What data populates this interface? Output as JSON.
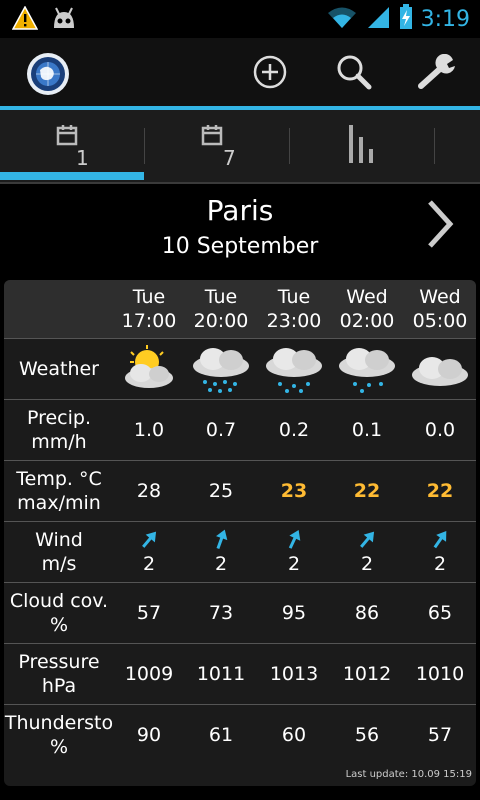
{
  "statusbar": {
    "time": "3:19",
    "icons": [
      "warning-icon",
      "android-robot-icon",
      "wifi-icon",
      "signal-icon",
      "battery-charging-icon"
    ],
    "accent": "#33b5e5"
  },
  "actionbar": {
    "logo": "weather-globe-logo",
    "buttons": [
      "add-icon",
      "search-icon",
      "settings-wrench-icon"
    ]
  },
  "tabs": [
    {
      "num": "1",
      "icon": "calendar-icon",
      "selected": true
    },
    {
      "num": "7",
      "icon": "calendar-icon",
      "selected": false
    },
    {
      "num": "",
      "icon": "bar-chart-icon",
      "selected": false
    }
  ],
  "location": {
    "city": "Paris",
    "date": "10 September"
  },
  "forecast": {
    "columns": [
      {
        "day": "Tue",
        "time": "17:00"
      },
      {
        "day": "Tue",
        "time": "20:00"
      },
      {
        "day": "Tue",
        "time": "23:00"
      },
      {
        "day": "Wed",
        "time": "02:00"
      },
      {
        "day": "Wed",
        "time": "05:00"
      }
    ],
    "rows": {
      "weather": {
        "label": "Weather",
        "icons": [
          "partly-sunny-cloud-icon",
          "rain-cloud-icon",
          "rain-cloud-icon",
          "rain-cloud-icon",
          "cloud-icon"
        ]
      },
      "precip": {
        "label_line1": "Precip.",
        "label_line2": "mm/h",
        "values": [
          "1.0",
          "0.7",
          "0.2",
          "0.1",
          "0.0"
        ]
      },
      "temp": {
        "label_line1": "Temp. °C",
        "label_line2": "max/min",
        "values": [
          "28",
          "25",
          "23",
          "22",
          "22"
        ],
        "warm_flags": [
          false,
          false,
          true,
          true,
          true
        ],
        "warm_color": "#ffbb33"
      },
      "wind": {
        "label_line1": "Wind",
        "label_line2": "m/s",
        "values": [
          "2",
          "2",
          "2",
          "2",
          "2"
        ],
        "arrow_icon": "wind-arrow-icon"
      },
      "cloud": {
        "label_line1": "Cloud cov.",
        "label_line2": "%",
        "values": [
          "57",
          "73",
          "95",
          "86",
          "65"
        ]
      },
      "pressure": {
        "label_line1": "Pressure",
        "label_line2": "hPa",
        "values": [
          "1009",
          "1011",
          "1013",
          "1012",
          "1010"
        ]
      },
      "thunder": {
        "label_line1": "Thundersto",
        "label_line2": "%",
        "values": [
          "90",
          "61",
          "60",
          "56",
          "57"
        ]
      }
    }
  },
  "last_update": "Last update: 10.09 15:19"
}
